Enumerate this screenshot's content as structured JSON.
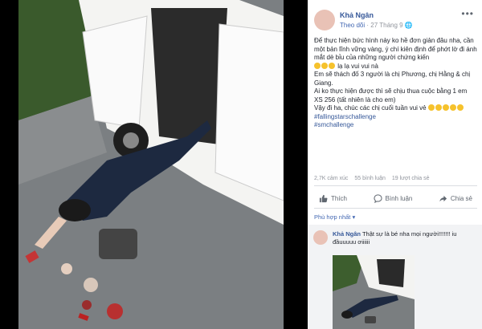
{
  "post": {
    "author": "Khả Ngân",
    "follow": "Theo dõi",
    "date": "27 Tháng 9",
    "more": "•••",
    "body": [
      "Để thực hiện bức hình này ko hề đơn giản đâu nha, cần một bản lĩnh vững vàng, ý chí kiên định để phớt lờ đi ánh mắt dè bỉu của những người chứng kiến",
      "lạ lạ vui vui nà",
      "Em sẽ thách đố 3 người là chị Phương, chị Hằng & chị Giang.",
      "Ai ko thực hiện được thì sẽ chịu thua cuộc bằng 1 em XS 256 (tất nhiên là cho em)",
      "Vậy đi ha, chúc các chị cuối tuần vui vẻ"
    ],
    "hashtags": [
      "#fallingstarschallenge",
      "#smchallenge"
    ],
    "stats": {
      "reactions": "2,7K cảm xúc",
      "comments": "55 bình luận",
      "shares": "19 lượt chia sẻ"
    },
    "actions": {
      "like": "Thích",
      "comment": "Bình luận",
      "share": "Chia sẻ"
    }
  },
  "comments": {
    "sort": "Phù hợp nhất",
    "items": [
      {
        "author": "Khả Ngân",
        "text": "Thật sự là bé nha mọi người!!!!!!! iu đầuuuuu ơiiiiii"
      }
    ]
  },
  "colors": {
    "link": "#365899",
    "accent": "#4267b2",
    "muted": "#90949c"
  }
}
